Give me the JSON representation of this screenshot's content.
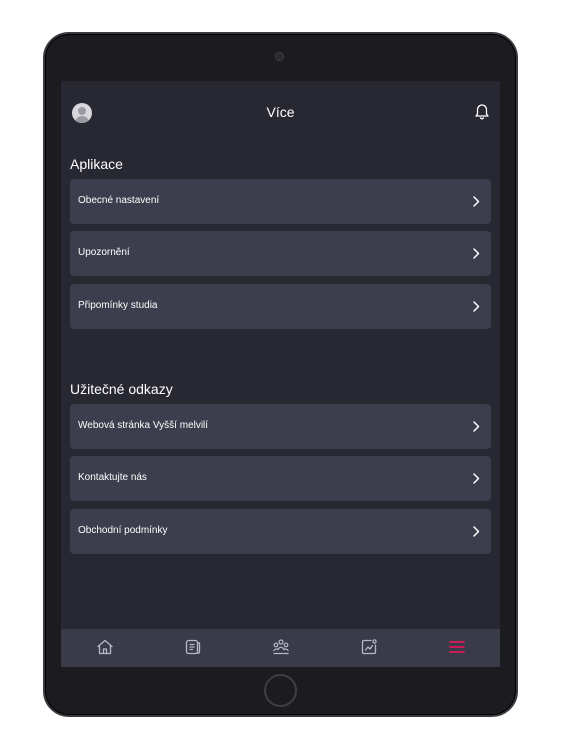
{
  "header": {
    "title": "Více",
    "avatar_icon": "user-avatar-icon",
    "notification_icon": "bell-icon"
  },
  "sections": [
    {
      "title": "Aplikace",
      "items": [
        {
          "label": "Obecné nastavení"
        },
        {
          "label": "Upozornění"
        },
        {
          "label": "Připomínky studia"
        }
      ]
    },
    {
      "title": "Užitečné odkazy",
      "items": [
        {
          "label": "Webová stránka Vyšší melvilí"
        },
        {
          "label": "Kontaktujte nás"
        },
        {
          "label": "Obchodní podmínky"
        }
      ]
    }
  ],
  "bottom_nav": {
    "items": [
      {
        "icon": "home-icon",
        "active": false
      },
      {
        "icon": "book-icon",
        "active": false
      },
      {
        "icon": "community-icon",
        "active": false
      },
      {
        "icon": "progress-chart-icon",
        "active": false
      },
      {
        "icon": "menu-icon",
        "active": true
      }
    ]
  },
  "colors": {
    "background": "#272831",
    "card": "#3d3e4d",
    "nav_bar": "#3a3b49",
    "nav_icon": "#b8b9c4",
    "accent": "#e0195b",
    "text": "#ffffff"
  }
}
